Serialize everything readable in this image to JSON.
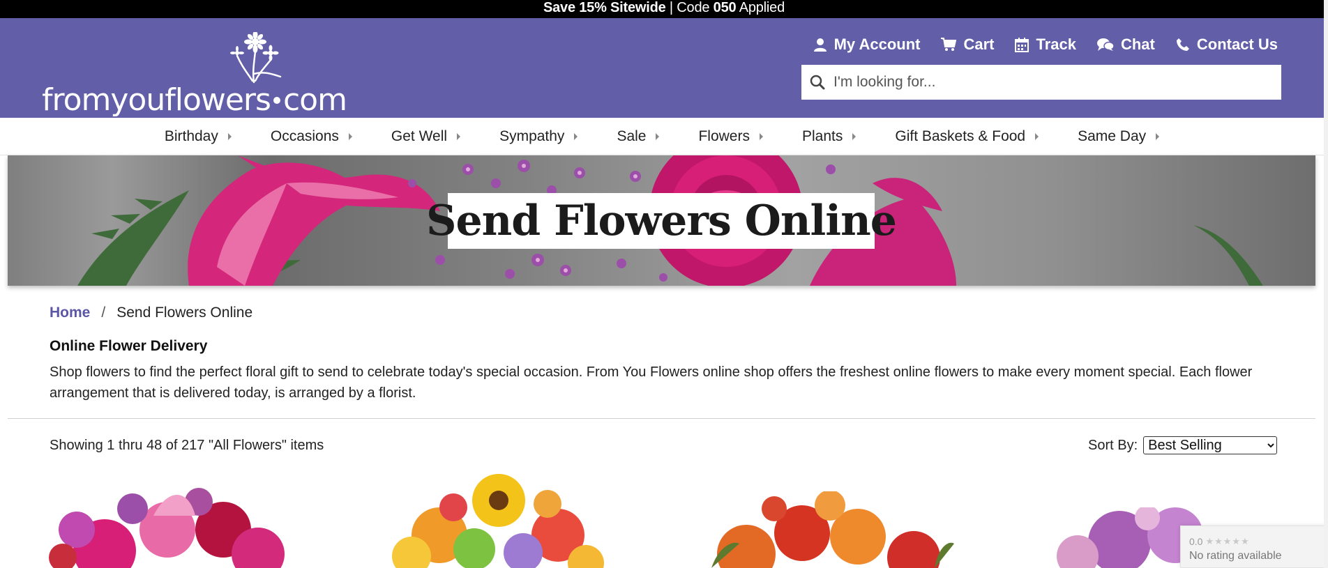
{
  "promo": {
    "bold_part": "Save 15% Sitewide",
    "separator": " | ",
    "code_label": "Code ",
    "code": "050",
    "suffix": " Applied"
  },
  "logo": {
    "text_left": "fromyouflowers",
    "text_right": "com"
  },
  "utility": [
    {
      "label": "My Account",
      "icon": "user-icon"
    },
    {
      "label": "Cart",
      "icon": "cart-icon"
    },
    {
      "label": "Track",
      "icon": "calendar-icon"
    },
    {
      "label": "Chat",
      "icon": "chat-icon"
    },
    {
      "label": "Contact Us",
      "icon": "phone-icon"
    }
  ],
  "search": {
    "placeholder": "I'm looking for..."
  },
  "nav": [
    {
      "label": "Birthday"
    },
    {
      "label": "Occasions"
    },
    {
      "label": "Get Well"
    },
    {
      "label": "Sympathy"
    },
    {
      "label": "Sale"
    },
    {
      "label": "Flowers"
    },
    {
      "label": "Plants"
    },
    {
      "label": "Gift Baskets & Food"
    },
    {
      "label": "Same Day"
    }
  ],
  "hero": {
    "title": "Send Flowers Online"
  },
  "breadcrumb": {
    "home": "Home",
    "separator": "/",
    "current": "Send Flowers Online"
  },
  "intro": {
    "title": "Online Flower Delivery",
    "text": "Shop flowers to find the perfect floral gift to send to celebrate today's special occasion. From You Flowers online shop offers the freshest online flowers to make every moment special. Each flower arrangement that is delivered today, is arranged by a florist."
  },
  "listing": {
    "showing": "Showing 1 thru 48 of 217 \"All Flowers\" items",
    "sort_label": "Sort By:",
    "sort_selected": "Best Selling"
  },
  "rating_badge": {
    "score": "0.0",
    "stars": "★★★★★",
    "text": "No rating available"
  },
  "colors": {
    "header": "#625ea8",
    "promo_bg": "#000000",
    "link": "#5b57a6"
  }
}
